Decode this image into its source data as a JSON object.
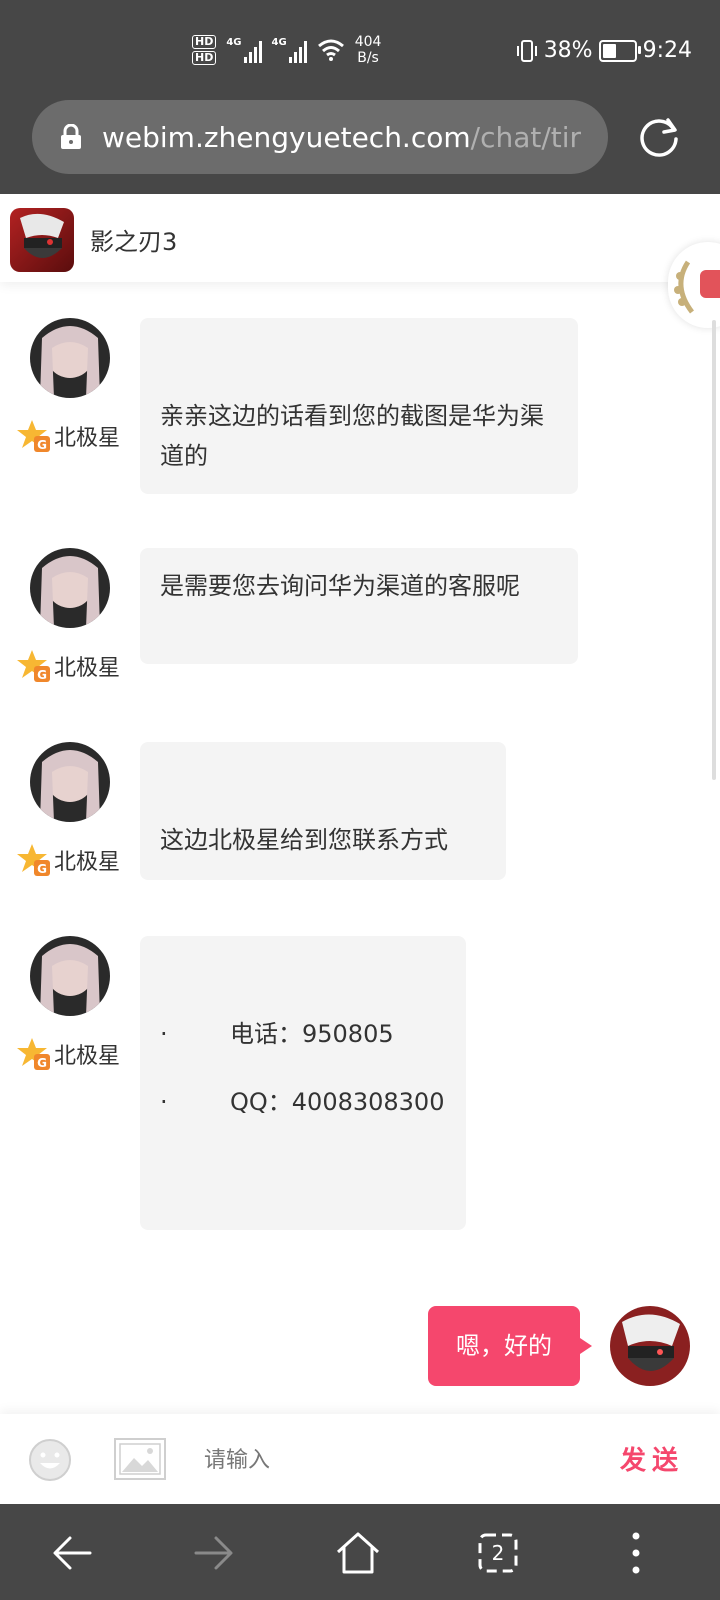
{
  "status_bar": {
    "hd1": "HD",
    "hd2": "HD",
    "sig1_label": "4G",
    "sig2_label": "4G",
    "speed_value": "404",
    "speed_unit": "B/s",
    "battery_percent": "38%",
    "battery_level": 0.38,
    "time": "9:24"
  },
  "browser": {
    "url_host": "webim.zhengyuetech.com",
    "url_path": "/chat/tir"
  },
  "chat": {
    "title": "影之刃3",
    "agent_name": "北极星",
    "messages": [
      {
        "text": "亲亲这边的话看到您的截图是华为渠道的"
      },
      {
        "text": "是需要您去询问华为渠道的客服呢"
      },
      {
        "text": "这边北极星给到您联系方式"
      },
      {
        "lines": [
          {
            "bullet": "·",
            "text": "电话：950805"
          },
          {
            "bullet": "·",
            "text": "QQ：4008308300"
          }
        ]
      }
    ],
    "my_message": "嗯，好的"
  },
  "input": {
    "placeholder": "请输入",
    "send_label": "发送"
  },
  "icons": {
    "lock": "lock-icon",
    "reload": "reload-icon",
    "emoji": "emoji-icon",
    "image": "image-icon",
    "back": "back-arrow-icon",
    "forward": "forward-arrow-icon",
    "home": "home-icon",
    "tabs": "tabs-icon",
    "menu": "more-vertical-icon"
  },
  "nav": {
    "tab_count": "2"
  },
  "colors": {
    "accent": "#f5476d",
    "bar_bg": "#474747",
    "bubble_bg": "#f4f4f4"
  }
}
